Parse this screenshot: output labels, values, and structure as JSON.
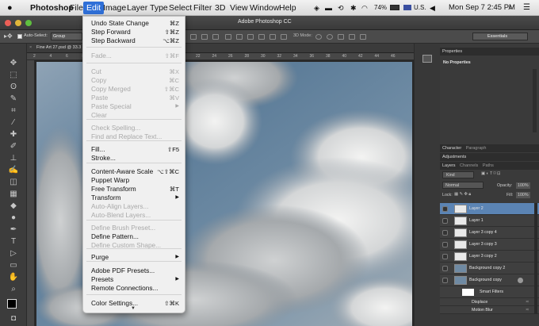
{
  "menubar": {
    "app_name": "Photoshop",
    "items": [
      "File",
      "Edit",
      "Image",
      "Layer",
      "Type",
      "Select",
      "Filter",
      "3D",
      "View",
      "Window",
      "Help"
    ],
    "battery": "74%",
    "input_source": "U.S.",
    "clock": "Mon Sep 7  2:45 PM"
  },
  "titlebar": {
    "title": "Adobe Photoshop CC",
    "workspace": "Essentials"
  },
  "options": {
    "auto_select_label": "Auto-Select:",
    "auto_select_value": "Group",
    "mode_label": "3D Mode:"
  },
  "document": {
    "tab_title": "Fine Art 27.psd @ 33.3",
    "ruler_numbers": [
      "2",
      "4",
      "6",
      "8",
      "10",
      "12",
      "14",
      "16",
      "18",
      "20",
      "22",
      "24",
      "26",
      "28",
      "30",
      "32",
      "34",
      "36",
      "38",
      "40",
      "42",
      "44",
      "46"
    ]
  },
  "edit_menu": {
    "items": [
      {
        "label": "Undo State Change",
        "shortcut": "⌘Z",
        "enabled": true
      },
      {
        "label": "Step Forward",
        "shortcut": "⇧⌘Z",
        "enabled": true
      },
      {
        "label": "Step Backward",
        "shortcut": "⌥⌘Z",
        "enabled": true
      },
      {
        "label": "Fade...",
        "shortcut": "⇧⌘F",
        "enabled": false
      },
      {
        "label": "Cut",
        "shortcut": "⌘X",
        "enabled": false
      },
      {
        "label": "Copy",
        "shortcut": "⌘C",
        "enabled": false
      },
      {
        "label": "Copy Merged",
        "shortcut": "⇧⌘C",
        "enabled": false
      },
      {
        "label": "Paste",
        "shortcut": "⌘V",
        "enabled": false
      },
      {
        "label": "Paste Special",
        "shortcut": "",
        "submenu": true,
        "enabled": false
      },
      {
        "label": "Clear",
        "shortcut": "",
        "enabled": false
      },
      {
        "label": "Check Spelling...",
        "shortcut": "",
        "enabled": false
      },
      {
        "label": "Find and Replace Text...",
        "shortcut": "",
        "enabled": false
      },
      {
        "label": "Fill...",
        "shortcut": "⇧F5",
        "enabled": true
      },
      {
        "label": "Stroke...",
        "shortcut": "",
        "enabled": true
      },
      {
        "label": "Content-Aware Scale",
        "shortcut": "⌥⇧⌘C",
        "enabled": true
      },
      {
        "label": "Puppet Warp",
        "shortcut": "",
        "enabled": true
      },
      {
        "label": "Free Transform",
        "shortcut": "⌘T",
        "enabled": true
      },
      {
        "label": "Transform",
        "shortcut": "",
        "submenu": true,
        "enabled": true
      },
      {
        "label": "Auto-Align Layers...",
        "shortcut": "",
        "enabled": false
      },
      {
        "label": "Auto-Blend Layers...",
        "shortcut": "",
        "enabled": false
      },
      {
        "label": "Define Brush Preset...",
        "shortcut": "",
        "enabled": false
      },
      {
        "label": "Define Pattern...",
        "shortcut": "",
        "enabled": true
      },
      {
        "label": "Define Custom Shape...",
        "shortcut": "",
        "enabled": false
      },
      {
        "label": "Purge",
        "shortcut": "",
        "submenu": true,
        "enabled": true
      },
      {
        "label": "Adobe PDF Presets...",
        "shortcut": "",
        "enabled": true
      },
      {
        "label": "Presets",
        "shortcut": "",
        "submenu": true,
        "enabled": true
      },
      {
        "label": "Remote Connections...",
        "shortcut": "",
        "enabled": true
      },
      {
        "label": "Color Settings...",
        "shortcut": "⇧⌘K",
        "enabled": true
      }
    ]
  },
  "properties": {
    "tab": "Properties",
    "empty_text": "No Properties"
  },
  "char_tabs": [
    "Character",
    "Paragraph"
  ],
  "adjustments_tab": "Adjustments",
  "layers_panel": {
    "tabs": [
      "Layers",
      "Channels",
      "Paths"
    ],
    "filter_label": "Kind",
    "blend_mode": "Normal",
    "opacity_label": "Opacity:",
    "opacity": "100%",
    "lock_label": "Lock:",
    "fill_label": "Fill:",
    "fill": "100%",
    "layers": [
      "Layer 2",
      "Layer 1",
      "Layer 3 copy 4",
      "Layer 3 copy 3",
      "Layer 3 copy 2",
      "Background copy 2",
      "Background copy"
    ],
    "smart_filters_label": "Smart Filters",
    "filters": [
      "Displace",
      "Motion Blur"
    ]
  },
  "colors": {
    "accent": "#2f6fd7",
    "selected_layer": "#5b84b4",
    "menu_bg": "#f0f0f0",
    "panel_bg": "#3a3a3a"
  }
}
